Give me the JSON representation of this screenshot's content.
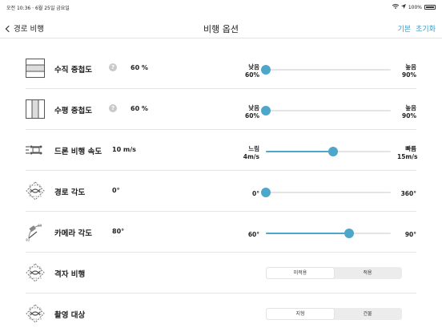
{
  "status_bar": {
    "time_date": "오전 10:36 · 6월 25일 금요일",
    "battery": "100%"
  },
  "nav": {
    "back_label": "경로 비행",
    "title": "비행 옵션",
    "default_label": "기본",
    "reset_label": "초기화"
  },
  "rows": [
    {
      "label": "수직 중첩도",
      "value": "60 %",
      "slider": {
        "min_label": "낮음",
        "min_value": "60%",
        "max_label": "높음",
        "max_value": "90%",
        "level": 0.0
      }
    },
    {
      "label": "수평 중첩도",
      "value": "60 %",
      "slider": {
        "min_label": "낮음",
        "min_value": "60%",
        "max_label": "높음",
        "max_value": "90%",
        "level": 0.0
      }
    },
    {
      "label": "드론 비행 속도",
      "value": "10 m/s",
      "slider": {
        "min_label": "느림",
        "min_value": "4m/s",
        "max_label": "빠름",
        "max_value": "15m/s",
        "level": 0.54
      }
    },
    {
      "label": "경로 각도",
      "value": "0°",
      "slider": {
        "min_label": "",
        "min_value": "0°",
        "max_label": "",
        "max_value": "360°",
        "level": 0.0
      }
    },
    {
      "label": "카메라 각도",
      "value": "80°",
      "slider": {
        "min_label": "",
        "min_value": "60°",
        "max_label": "",
        "max_value": "90°",
        "level": 0.667
      }
    },
    {
      "label": "격자 비행",
      "segment": {
        "options": [
          "미적용",
          "적용"
        ],
        "selected": 0
      }
    },
    {
      "label": "촬영 대상",
      "segment": {
        "options": [
          "지형",
          "건물"
        ],
        "selected": 0
      }
    }
  ],
  "icons": {
    "vertical_overlap": "vertical-overlap-icon",
    "horizontal_overlap": "horizontal-overlap-icon",
    "drone_speed": "drone-speed-icon",
    "path_angle": "path-angle-icon",
    "camera_angle": "camera-angle-icon",
    "grid_flight": "grid-flight-icon",
    "capture_target": "capture-target-icon"
  },
  "colors": {
    "accent": "#4da7cb",
    "link": "#3a9cc4"
  }
}
